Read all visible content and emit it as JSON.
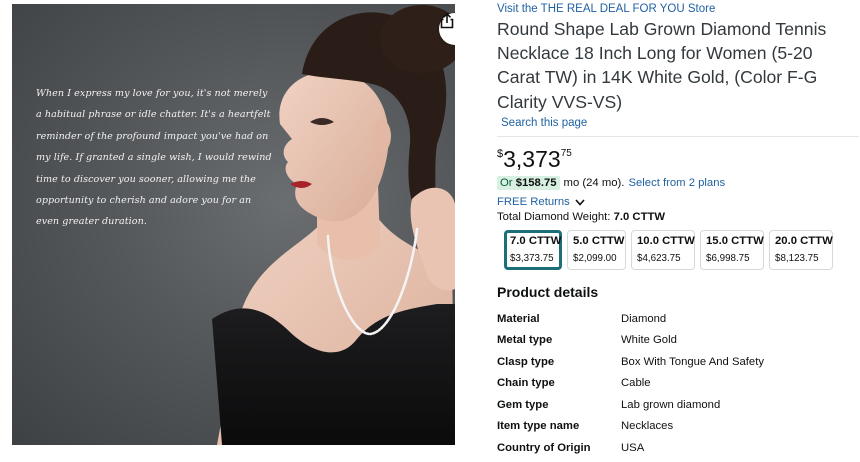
{
  "image": {
    "quote": "When I express my love for you, it's not merely a habitual phrase or idle chatter. It's a heartfelt reminder of the profound impact you've had on my life. If granted a single wish, I would rewind time to discover you sooner, allowing me the opportunity to cherish and adore you for an even greater duration.",
    "share_icon": "share-icon"
  },
  "product": {
    "store_link": "Visit the THE REAL DEAL FOR YOU Store",
    "title": "Round Shape Lab Grown Diamond Tennis Necklace 18 Inch Long for Women (5-20 Carat TW) in 14K White Gold, (Color F-G Clarity VVS-VS)",
    "search_page": "Search this page"
  },
  "price": {
    "currency": "$",
    "whole": "3,373",
    "fraction": "75"
  },
  "monthly": {
    "prefix": "Or ",
    "amount": "$158.75",
    "term": " mo (24 mo).",
    "plans_link": "Select from 2 plans"
  },
  "returns": {
    "label": "FREE Returns",
    "icon": "chevron-down-icon"
  },
  "weight": {
    "label": "Total Diamond Weight: ",
    "selected": "7.0 CTTW"
  },
  "options": [
    {
      "name": "7.0 CTTW",
      "price": "$3,373.75",
      "selected": true
    },
    {
      "name": "5.0 CTTW",
      "price": "$2,099.00",
      "selected": false
    },
    {
      "name": "10.0 CTTW",
      "price": "$4,623.75",
      "selected": false
    },
    {
      "name": "15.0 CTTW",
      "price": "$6,998.75",
      "selected": false
    },
    {
      "name": "20.0 CTTW",
      "price": "$8,123.75",
      "selected": false
    }
  ],
  "product_details": {
    "title": "Product details",
    "rows": [
      {
        "key": "Material",
        "value": "Diamond"
      },
      {
        "key": "Metal type",
        "value": "White Gold"
      },
      {
        "key": "Clasp type",
        "value": "Box With Tongue And Safety"
      },
      {
        "key": "Chain type",
        "value": "Cable"
      },
      {
        "key": "Gem type",
        "value": "Lab grown diamond"
      },
      {
        "key": "Item type name",
        "value": "Necklaces"
      },
      {
        "key": "Country of Origin",
        "value": "USA"
      }
    ]
  },
  "colors": {
    "link": "#2162a1",
    "selected_border": "#1c6e78",
    "badge_bg": "#d7f0e2"
  }
}
